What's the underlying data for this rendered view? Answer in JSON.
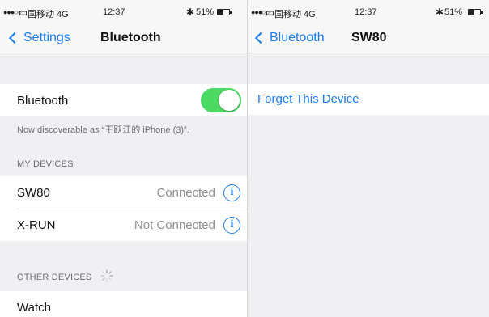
{
  "left": {
    "status_bar": {
      "signal": "●●●○○",
      "carrier": "中国移动 4G",
      "time": "12:37",
      "bluetooth_glyph": "✱",
      "battery": "51%",
      "battery_level": 0.51
    },
    "nav": {
      "back_label": "Settings",
      "title": "Bluetooth"
    },
    "bluetooth_row": {
      "label": "Bluetooth",
      "toggle_on": true
    },
    "discoverable_note": "Now discoverable as “王跃江的 iPhone (3)”.",
    "my_devices_header": "MY DEVICES",
    "my_devices": [
      {
        "name": "SW80",
        "status": "Connected",
        "info_glyph": "i"
      },
      {
        "name": "X-RUN",
        "status": "Not Connected",
        "info_glyph": "i"
      }
    ],
    "other_devices_header": "OTHER DEVICES",
    "other_devices": [
      {
        "name": "Watch"
      }
    ]
  },
  "right": {
    "status_bar": {
      "signal": "●●●○○",
      "carrier": "中国移动 4G",
      "time": "12:37",
      "bluetooth_glyph": "✱",
      "battery": "51%",
      "battery_level": 0.51
    },
    "nav": {
      "back_label": "Bluetooth",
      "title": "SW80"
    },
    "forget_label": "Forget This Device"
  },
  "colors": {
    "accent": "#1a7cf5",
    "toggle_on": "#4cd964",
    "background": "#f0f0f2",
    "secondary_text": "#8e8e93"
  }
}
